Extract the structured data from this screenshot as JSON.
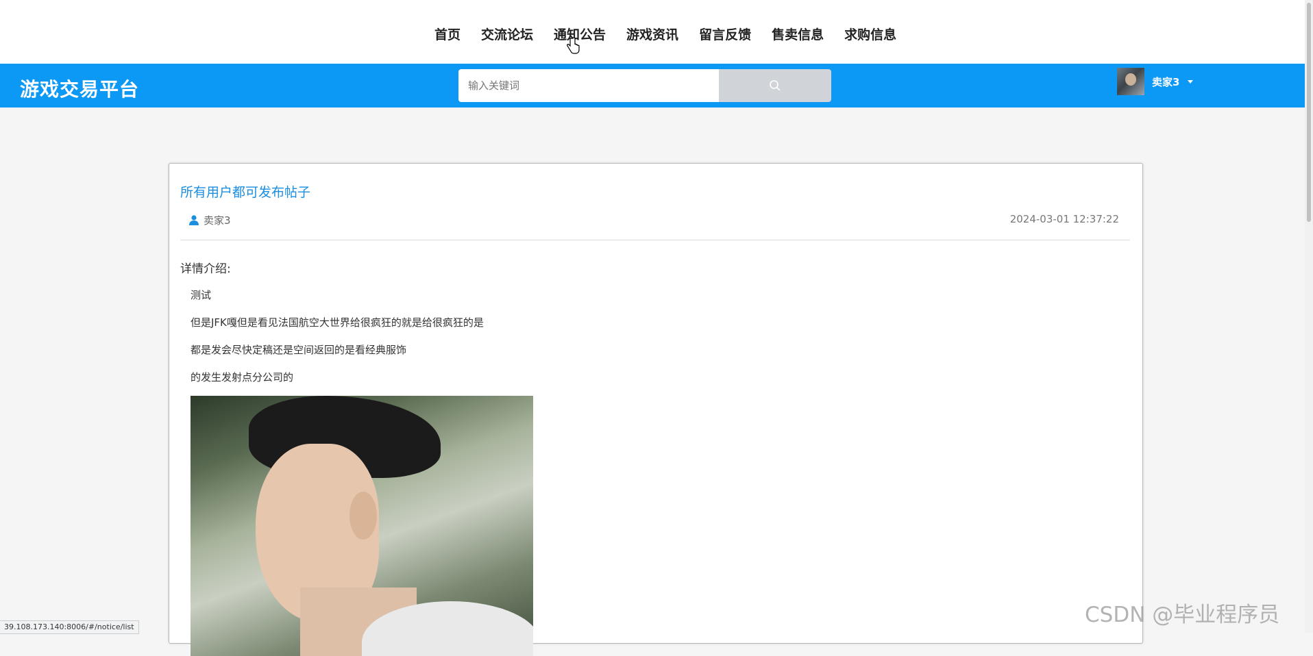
{
  "nav": {
    "items": [
      "首页",
      "交流论坛",
      "通知公告",
      "游戏资讯",
      "留言反馈",
      "售卖信息",
      "求购信息"
    ]
  },
  "header": {
    "brand": "游戏交易平台",
    "search_placeholder": "输入关键词",
    "username": "卖家3"
  },
  "post": {
    "title": "所有用户都可发布帖子",
    "author": "卖家3",
    "date": "2024-03-01 12:37:22",
    "section_label": "详情介绍:",
    "paragraphs": [
      "测试",
      "但是JFK嘎但是看见法国航空大世界给很疯狂的就是给很疯狂的是",
      "都是发会尽快定稿还是空间返回的是看经典服饰",
      "的发生发射点分公司的"
    ]
  },
  "status_url": "39.108.173.140:8006/#/notice/list",
  "watermark": "CSDN @毕业程序员"
}
